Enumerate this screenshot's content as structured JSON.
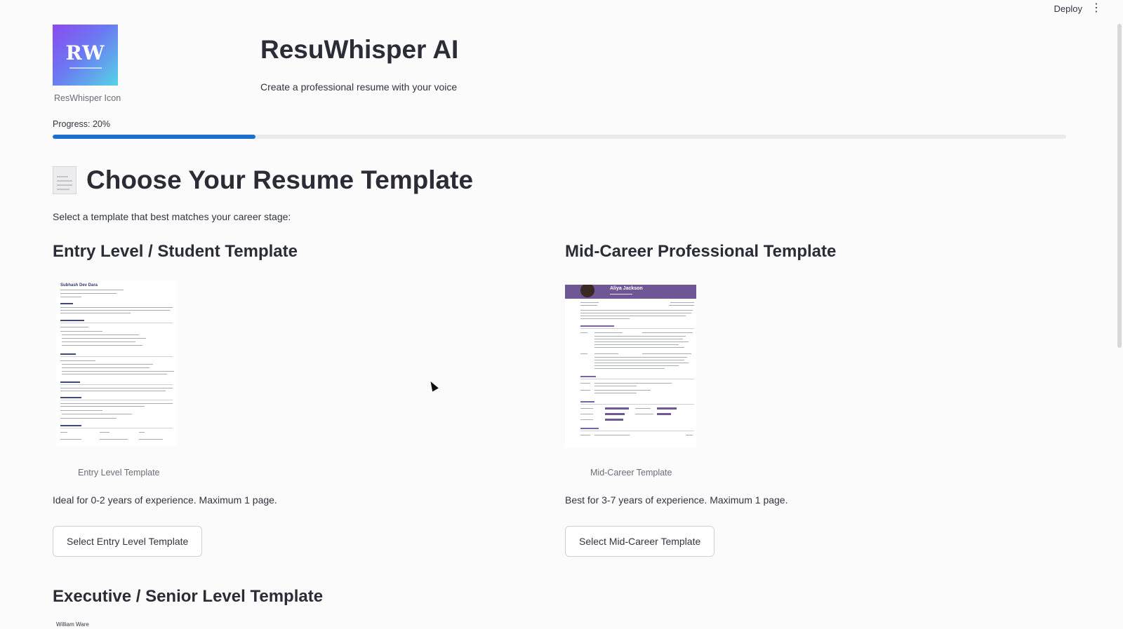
{
  "toolbar": {
    "deploy_label": "Deploy",
    "menu_glyph": "⋮"
  },
  "brand": {
    "logo_text": "RW",
    "logo_caption": "ResWhisper Icon",
    "title": "ResuWhisper AI",
    "subtitle": "Create a professional resume with your voice"
  },
  "progress": {
    "label": "Progress: 20%",
    "value": 0.2
  },
  "main": {
    "title": "Choose Your Resume Template",
    "description": "Select a template that best matches your career stage:"
  },
  "templates": [
    {
      "title": "Entry Level / Student Template",
      "preview_name": "Subhash Dev Dara",
      "caption": "Entry Level Template",
      "description": "Ideal for 0-2 years of experience. Maximum 1 page.",
      "button_label": "Select Entry Level Template"
    },
    {
      "title": "Mid-Career Professional Template",
      "preview_name": "Aliya Jackson",
      "caption": "Mid-Career Template",
      "description": "Best for 3-7 years of experience. Maximum 1 page.",
      "button_label": "Select Mid-Career Template"
    },
    {
      "title": "Executive / Senior Level Template",
      "preview_name": "William Ware"
    }
  ],
  "colors": {
    "accent": "#1f6fd1",
    "mid_header": "#6f5695"
  }
}
